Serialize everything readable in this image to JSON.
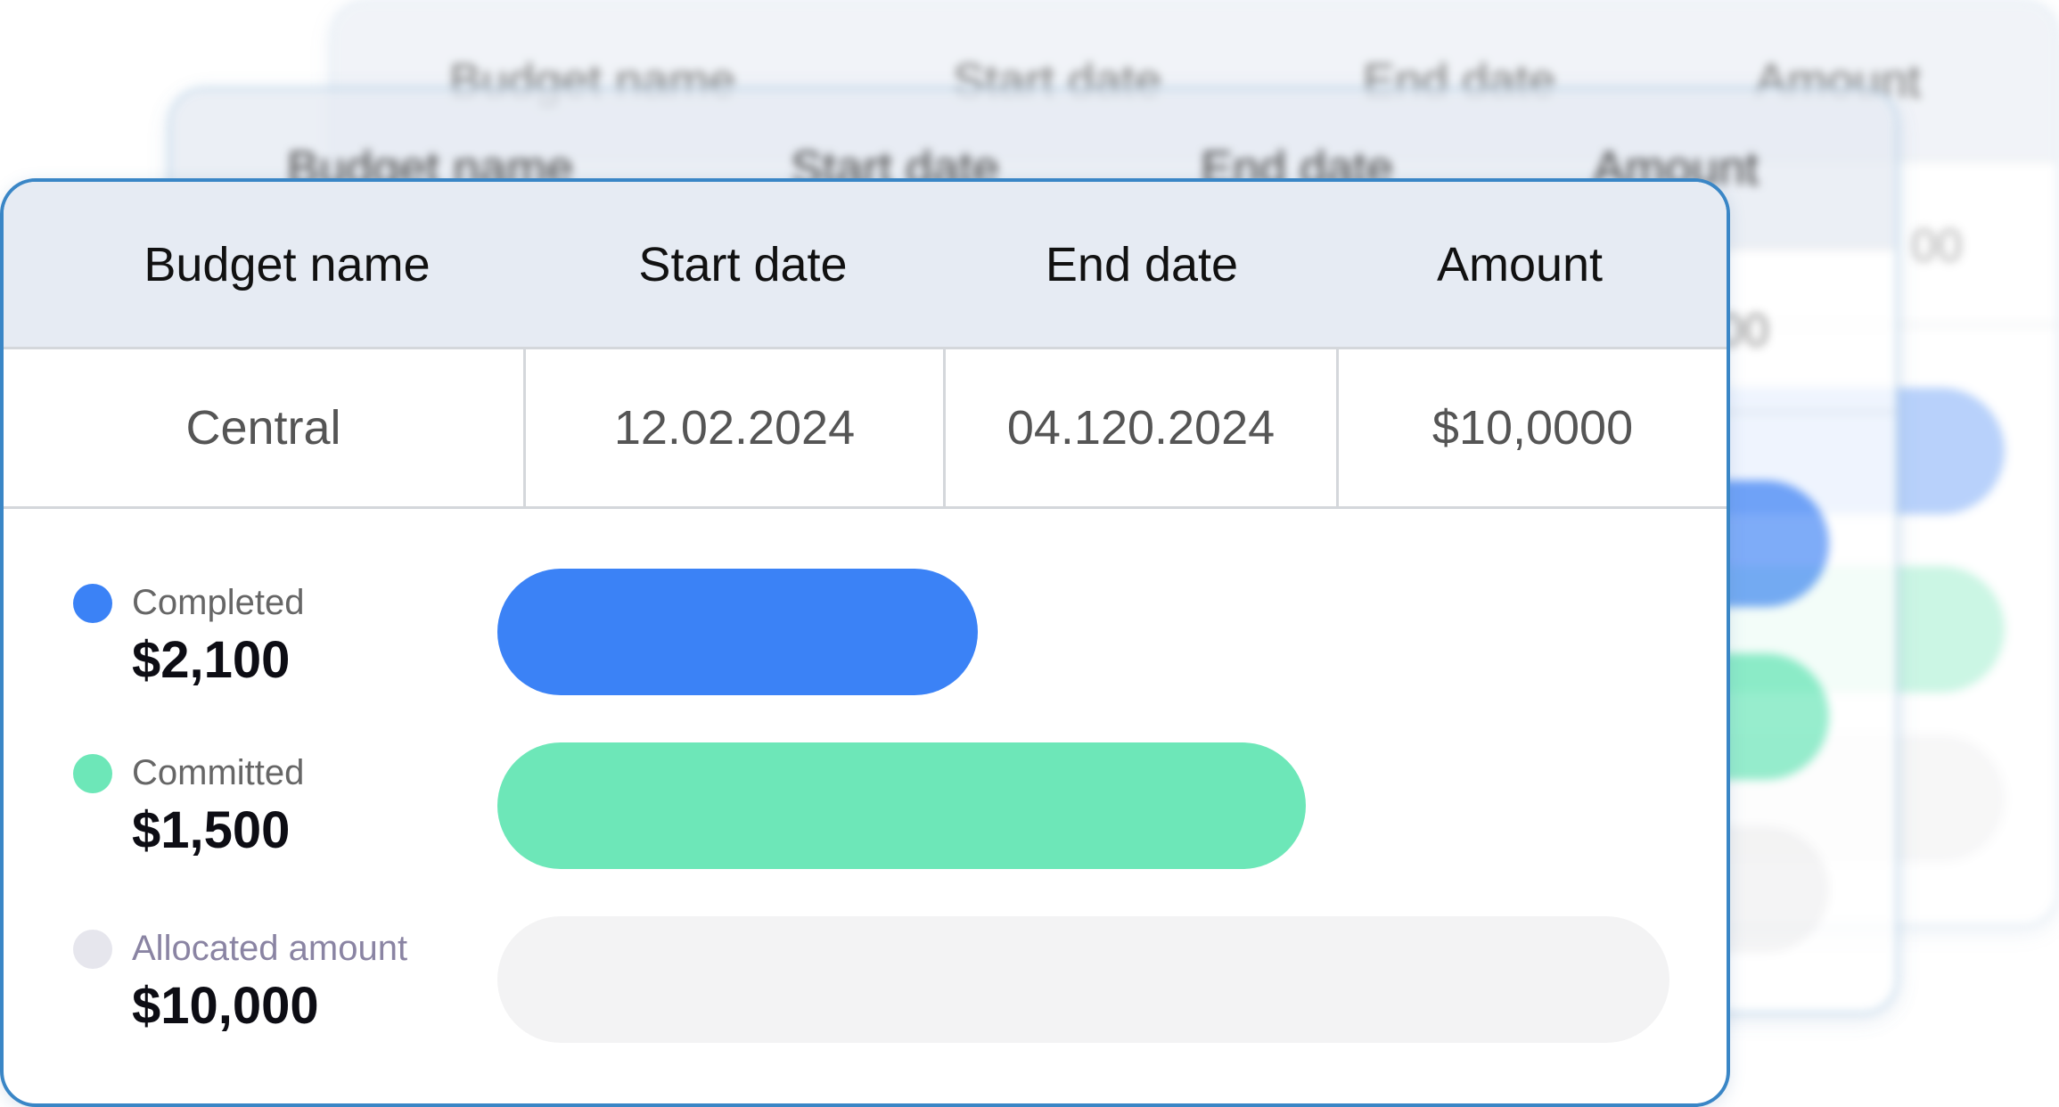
{
  "colors": {
    "completed": "#3b82f6",
    "committed": "#6de7b8",
    "allocated": "#f3f3f4",
    "allocated_dot": "#e6e6ed",
    "header_bg": "#e6ebf3",
    "card_border": "#3a86c6"
  },
  "table": {
    "headers": [
      "Budget name",
      "Start date",
      "End date",
      "Amount"
    ],
    "row": {
      "budget_name": "Central",
      "start_date": "12.02.2024",
      "end_date": "04.120.2024",
      "amount": "$10,0000"
    }
  },
  "legend": [
    {
      "label": "Completed",
      "value": "$2,100",
      "fill_fraction": 0.41
    },
    {
      "label": "Committed",
      "value": "$1,500",
      "fill_fraction": 0.69
    },
    {
      "label": "Allocated amount",
      "value": "$10,000",
      "fill_fraction": 1.0
    }
  ],
  "back_cards": {
    "headers": [
      "Budget name",
      "Start date",
      "End date",
      "Amount"
    ],
    "partial_values": [
      "00",
      "00"
    ]
  }
}
